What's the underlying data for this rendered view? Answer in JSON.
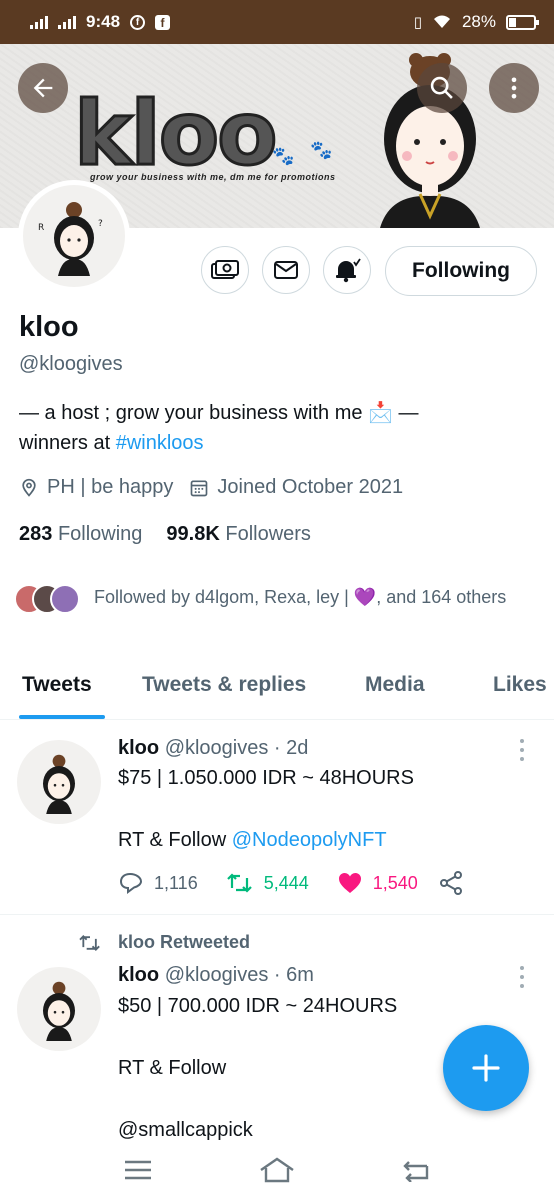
{
  "status_bar": {
    "time": "9:48",
    "battery": "28%",
    "battery_level": 0.28
  },
  "banner": {
    "title": "kloo",
    "tagline": "grow your business with me, dm me for promotions"
  },
  "profile": {
    "name": "kloo",
    "handle": "@kloogives",
    "bio_text": "— a host ; grow your business with me 📩 —",
    "bio_line2_prefix": "winners at ",
    "bio_hashtag": "#winkloos",
    "location": "PH | be happy",
    "joined": "Joined October 2021",
    "following_count": "283",
    "following_label": "Following",
    "followers_count": "99.8K",
    "followers_label": "Followers",
    "followed_by": "Followed by d4lgom, Rexa, ley | 💜, and 164 others",
    "follow_button": "Following"
  },
  "tabs": [
    {
      "label": "Tweets",
      "active": true
    },
    {
      "label": "Tweets & replies",
      "active": false
    },
    {
      "label": "Media",
      "active": false
    },
    {
      "label": "Likes",
      "active": false
    }
  ],
  "tweets": [
    {
      "name": "kloo",
      "meta": "@kloogives · 2d",
      "line1": "$75 | 1.050.000 IDR ~ 48HOURS",
      "line2_prefix": "RT & Follow ",
      "line2_mention": "@NodeopolyNFT",
      "replies": "1,116",
      "retweets": "5,444",
      "likes": "1,540"
    },
    {
      "retweeted_by": "kloo Retweeted",
      "name": "kloo",
      "meta": "@kloogives · 6m",
      "line1": "$50 | 700.000 IDR ~ 24HOURS",
      "line2": "RT & Follow",
      "line3_mention": "@smallcappick"
    }
  ],
  "colors": {
    "accent": "#1d9bf0",
    "retweet": "#00ba7c",
    "like": "#f91880",
    "status_bar": "#5a3a22"
  }
}
